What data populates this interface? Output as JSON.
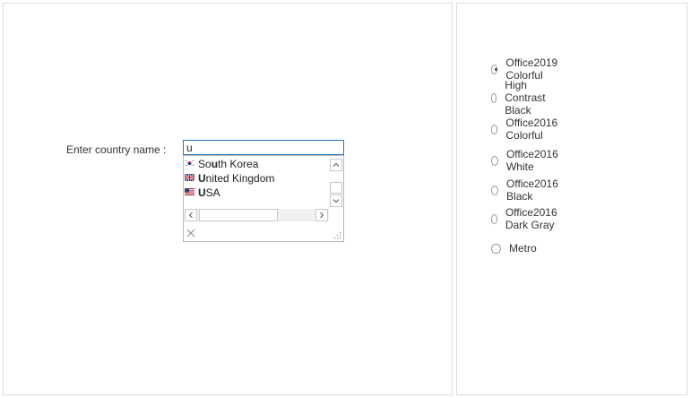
{
  "autocomplete": {
    "label": "Enter country name :",
    "input_value": "u",
    "items": [
      {
        "pre": "So",
        "hl": "u",
        "post": "th Korea",
        "flag": "south-korea-flag-icon"
      },
      {
        "pre": "",
        "hl": "U",
        "post": "nited Kingdom",
        "flag": "uk-flag-icon"
      },
      {
        "pre": "",
        "hl": "U",
        "post": "SA",
        "flag": "usa-flag-icon"
      }
    ]
  },
  "themes": {
    "selected_index": 0,
    "options": [
      "Office2019 Colorful",
      "High Contrast Black",
      "Office2016 Colorful",
      "Office2016 White",
      "Office2016 Black",
      "Office2016 Dark Gray",
      "Metro"
    ]
  },
  "colors": {
    "input_border": "#1f78c8",
    "panel_border": "#dcdcdc",
    "text": "#333333"
  }
}
